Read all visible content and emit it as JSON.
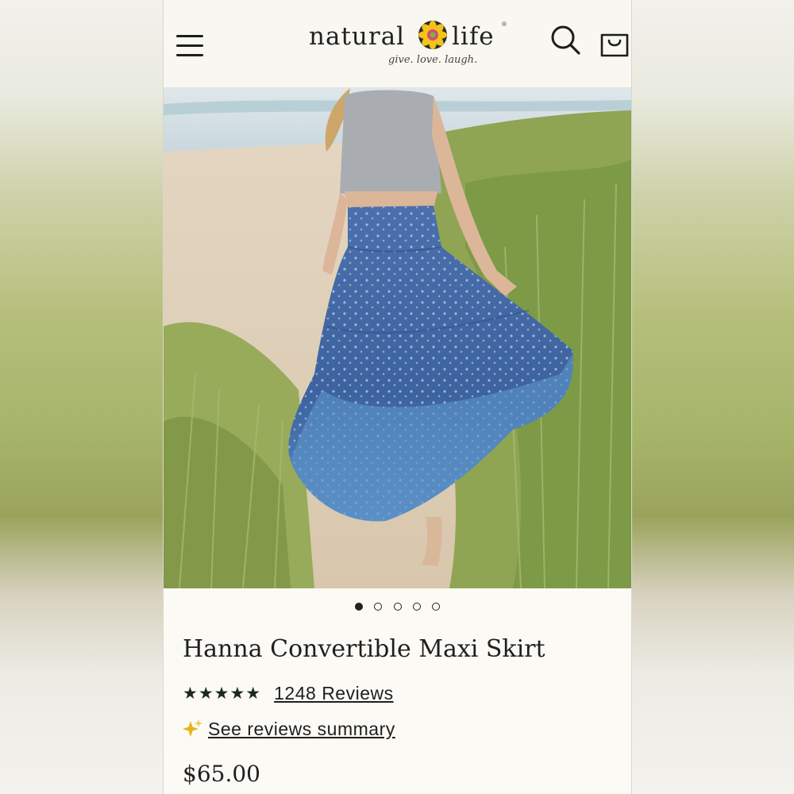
{
  "header": {
    "logo_word_left": "natural",
    "logo_word_right": "life",
    "logo_tagline": "give. love. laugh.",
    "icons": [
      "hamburger-menu-icon",
      "search-icon",
      "shopping-bag-icon"
    ]
  },
  "product": {
    "title": "Hanna Convertible Maxi Skirt",
    "rating_stars": 5,
    "stars_text": "★★★★★",
    "reviews_link": "1248 Reviews",
    "summary_link": "See reviews summary",
    "price": "$65.00"
  },
  "gallery": {
    "image_count": 5,
    "active_index": 0
  },
  "colors": {
    "page_bg": "#fbfaf5",
    "text": "#1f1f1f",
    "sparkle": "#e8b21a",
    "skirt_blue": "#3f6aa8"
  }
}
